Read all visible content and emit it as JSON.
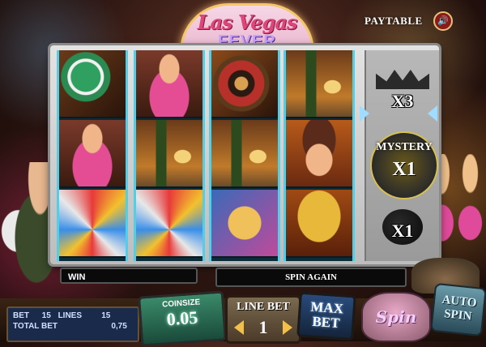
{
  "header": {
    "logo_title": "Las Vegas",
    "logo_sub": "FEVER",
    "paytable_label": "PAYTABLE",
    "sound_icon": "speaker-icon"
  },
  "reels": [
    {
      "symbols": [
        "chips",
        "girl-pink",
        "wheel"
      ]
    },
    {
      "symbols": [
        "girl-pink",
        "champagne",
        "wheel"
      ]
    },
    {
      "symbols": [
        "roulette",
        "champagne",
        "logo"
      ]
    },
    {
      "symbols": [
        "champagne",
        "girl-gold",
        "girl-gold"
      ]
    }
  ],
  "side_reel": {
    "top_multiplier": "X3",
    "mystery_label": "MYSTERY",
    "mystery_multiplier": "X1",
    "bottom_multiplier": "X1"
  },
  "status": {
    "win_label": "WIN",
    "message": "SPIN AGAIN"
  },
  "info": {
    "bet_label": "BET",
    "bet_value": "15",
    "lines_label": "LINES",
    "lines_value": "15",
    "total_bet_label": "TOTAL BET",
    "total_bet_value": "0,75"
  },
  "controls": {
    "coinsize_label": "COINSIZE",
    "coinsize_value": "0.05",
    "linebet_label": "LINE BET",
    "linebet_value": "1",
    "maxbet_line1": "MAX",
    "maxbet_line2": "BET",
    "spin_label": "Spin",
    "autospin_line1": "AUTO",
    "autospin_line2": "SPIN"
  }
}
